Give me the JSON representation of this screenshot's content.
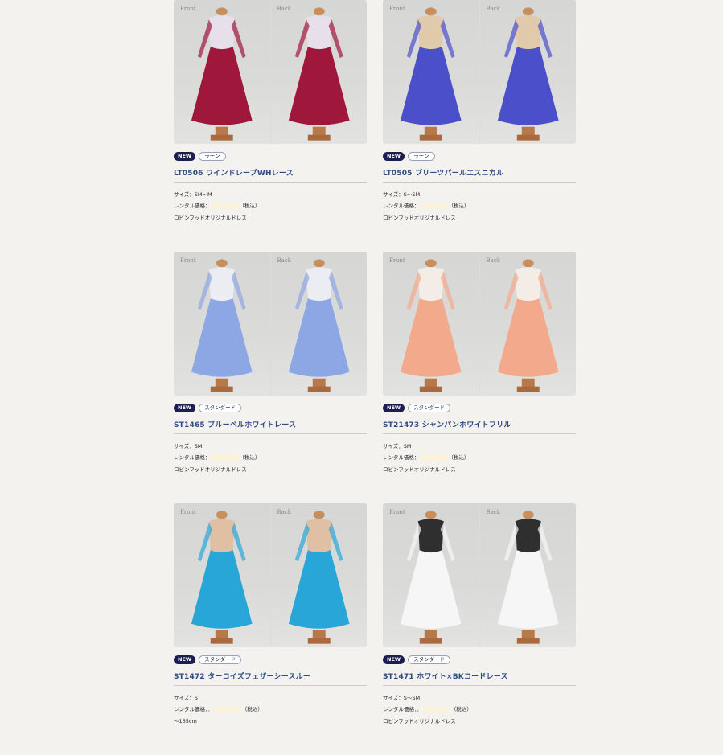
{
  "cards": [
    {
      "front_label": "Front",
      "back_label": "Back",
      "badge_new": "NEW",
      "category": "ラテン",
      "title": "LT0506 ワインドレープWHレース",
      "size": "サイズ：SM〜M",
      "price_label": "レンタル価格：",
      "price_tax": "（税込）",
      "brand": "ロビンフッドオリジナルドレス",
      "colors": {
        "dress": "#a0173c",
        "accent": "#e9e0ec"
      }
    },
    {
      "front_label": "Front",
      "back_label": "Back",
      "badge_new": "NEW",
      "category": "ラテン",
      "title": "LT0505 プリーツパールエスニカル",
      "size": "サイズ：S〜SM",
      "price_label": "レンタル価格：",
      "price_tax": "（税込）",
      "brand": "ロビンフッドオリジナルドレス",
      "colors": {
        "dress": "#4b4fc9",
        "accent": "#e2c8a6"
      }
    },
    {
      "front_label": "Front",
      "back_label": "Back",
      "badge_new": "NEW",
      "category": "スタンダード",
      "title": "ST1465 ブルーベルホワイトレース",
      "size": "サイズ：SM",
      "price_label": "レンタル価格：",
      "price_tax": "（税込）",
      "brand": "ロビンフッドオリジナルドレス",
      "colors": {
        "dress": "#8da6e4",
        "accent": "#eef0f6"
      }
    },
    {
      "front_label": "Front",
      "back_label": "Back",
      "badge_new": "NEW",
      "category": "スタンダード",
      "title": "ST21473 シャンパンホワイトフリル",
      "size": "サイズ：SM",
      "price_label": "レンタル価格：",
      "price_tax": "（税込）",
      "brand": "ロビンフッドオリジナルドレス",
      "colors": {
        "dress": "#f3a98c",
        "accent": "#f7efe9"
      }
    },
    {
      "front_label": "Front",
      "back_label": "Back",
      "badge_new": "NEW",
      "category": "スタンダード",
      "title": "ST1472 ターコイズフェザーシースルー",
      "size": "サイズ：S",
      "price_label": "レンタル価格：：",
      "price_tax": "（税込）",
      "brand": "〜165cm",
      "colors": {
        "dress": "#29a6d8",
        "accent": "#e0bea0"
      }
    },
    {
      "front_label": "Front",
      "back_label": "Back",
      "badge_new": "NEW",
      "category": "スタンダード",
      "title": "ST1471 ホワイト×BKコードレース",
      "size": "サイズ：S〜SM",
      "price_label": "レンタル価格：：",
      "price_tax": "（税込）",
      "brand": "ロビンフッドオリジナルドレス",
      "colors": {
        "dress": "#f6f6f6",
        "accent": "#1d1d1d"
      }
    }
  ]
}
